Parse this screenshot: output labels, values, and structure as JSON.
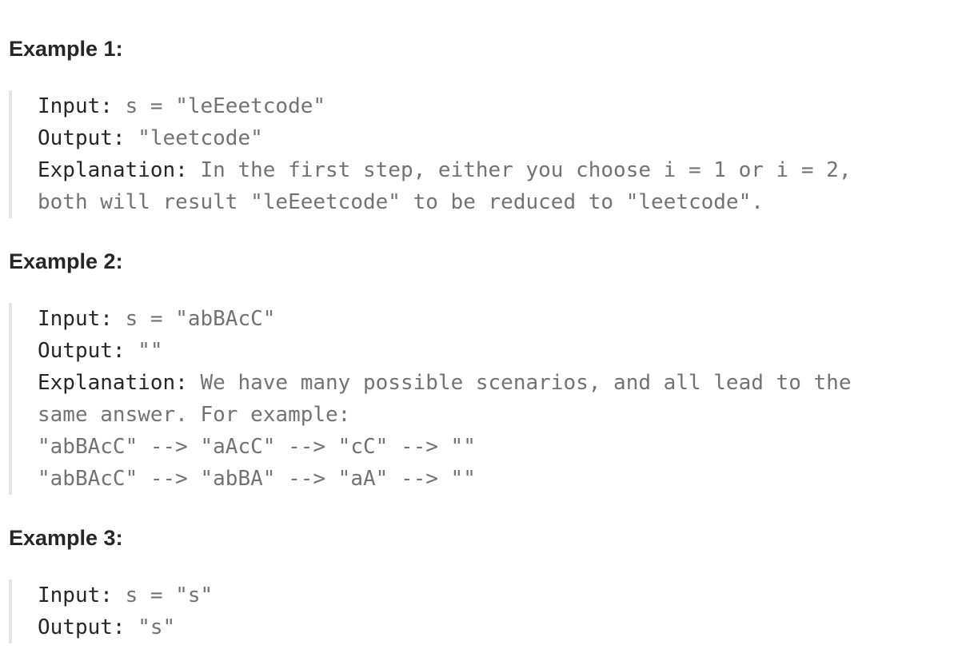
{
  "examples": [
    {
      "heading": "Example 1:",
      "input_label": "Input:",
      "input_value": " s = \"leEeetcode\"",
      "output_label": "Output:",
      "output_value": " \"leetcode\"",
      "explanation_label": "Explanation:",
      "explanation_lines": [
        " In the first step, either you choose i = 1 or i = 2,",
        "both will result \"leEeetcode\" to be reduced to \"leetcode\"."
      ]
    },
    {
      "heading": "Example 2:",
      "input_label": "Input:",
      "input_value": " s = \"abBAcC\"",
      "output_label": "Output:",
      "output_value": " \"\"",
      "explanation_label": "Explanation:",
      "explanation_lines": [
        " We have many possible scenarios, and all lead to the",
        "same answer. For example:",
        "\"abBAcC\" --> \"aAcC\" --> \"cC\" --> \"\"",
        "\"abBAcC\" --> \"abBA\" --> \"aA\" --> \"\""
      ]
    },
    {
      "heading": "Example 3:",
      "input_label": "Input:",
      "input_value": " s = \"s\"",
      "output_label": "Output:",
      "output_value": " \"s\""
    }
  ]
}
